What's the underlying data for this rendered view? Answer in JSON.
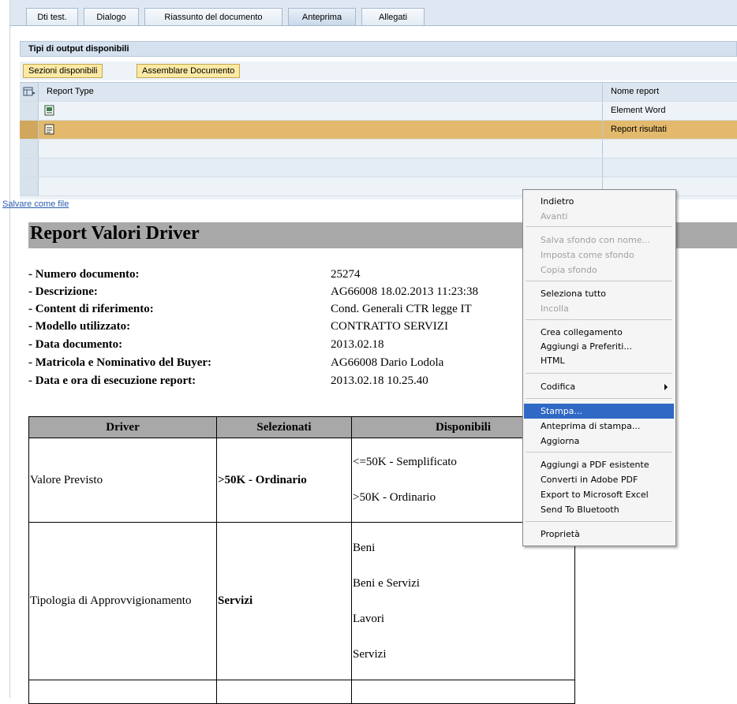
{
  "tabs": [
    "Dti test.",
    "Dialogo",
    "Riassunto del documento",
    "Anteprima",
    "Allegati"
  ],
  "active_tab": "Anteprima",
  "panel": {
    "title": "Tipi di output disponibili",
    "buttons": [
      "Sezioni disponibili",
      "Assemblare Documento"
    ]
  },
  "grid": {
    "headers": [
      "Report Type",
      "Nome report"
    ],
    "rows": [
      {
        "icon": "word-document-icon",
        "name": "Element Word"
      },
      {
        "icon": "report-document-icon",
        "name": "Report risultati",
        "selected": true
      }
    ],
    "highlight_color": "#e3b96d"
  },
  "save_link": "Salvare come file",
  "report": {
    "title": "Report Valori Driver",
    "fields": [
      {
        "label": "- Numero documento:",
        "value": "25274"
      },
      {
        "label": "- Descrizione:",
        "value": "AG66008 18.02.2013 11:23:38"
      },
      {
        "label": "- Content di riferimento:",
        "value": "Cond. Generali CTR legge IT"
      },
      {
        "label": "- Modello utilizzato:",
        "value": "CONTRATTO SERVIZI"
      },
      {
        "label": "- Data documento:",
        "value": "2013.02.18"
      },
      {
        "label": "- Matricola e Nominativo del Buyer:",
        "value": "AG66008 Dario Lodola"
      },
      {
        "label": "- Data e ora di esecuzione report:",
        "value": "2013.02.18 10.25.40"
      }
    ],
    "table": {
      "headers": [
        "Driver",
        "Selezionati",
        "Disponibili"
      ],
      "rows": [
        {
          "driver": "Valore Previsto",
          "selected": ">50K - Ordinario",
          "available": [
            "<=50K - Semplificato",
            ">50K - Ordinario"
          ]
        },
        {
          "driver": "Tipologia di Approvvigionamento",
          "selected": "Servizi",
          "available": [
            "Beni",
            "Beni e Servizi",
            "Lavori",
            "Servizi"
          ]
        }
      ]
    }
  },
  "context_menu": {
    "items": [
      {
        "label": "Indietro",
        "disabled": false
      },
      {
        "label": "Avanti",
        "disabled": true
      },
      {
        "label": "Salva sfondo con nome...",
        "disabled": true
      },
      {
        "label": "Imposta come sfondo",
        "disabled": true
      },
      {
        "label": "Copia sfondo",
        "disabled": true
      },
      {
        "label": "Seleziona tutto",
        "disabled": false
      },
      {
        "label": "Incolla",
        "disabled": true
      },
      {
        "label": "Crea collegamento",
        "disabled": false
      },
      {
        "label": "Aggiungi a Preferiti...",
        "disabled": false
      },
      {
        "label": "HTML",
        "disabled": false
      },
      {
        "label": "Codifica",
        "disabled": false,
        "submenu": true
      },
      {
        "label": "Stampa...",
        "disabled": false,
        "highlighted": true
      },
      {
        "label": "Anteprima di stampa...",
        "disabled": false
      },
      {
        "label": "Aggiorna",
        "disabled": false
      },
      {
        "label": "Aggiungi a PDF esistente",
        "disabled": false
      },
      {
        "label": "Converti in Adobe PDF",
        "disabled": false
      },
      {
        "label": "Export to Microsoft Excel",
        "disabled": false
      },
      {
        "label": "Send To Bluetooth",
        "disabled": false
      },
      {
        "label": "Proprietà",
        "disabled": false
      }
    ],
    "highlight_color": "#3068c6"
  }
}
